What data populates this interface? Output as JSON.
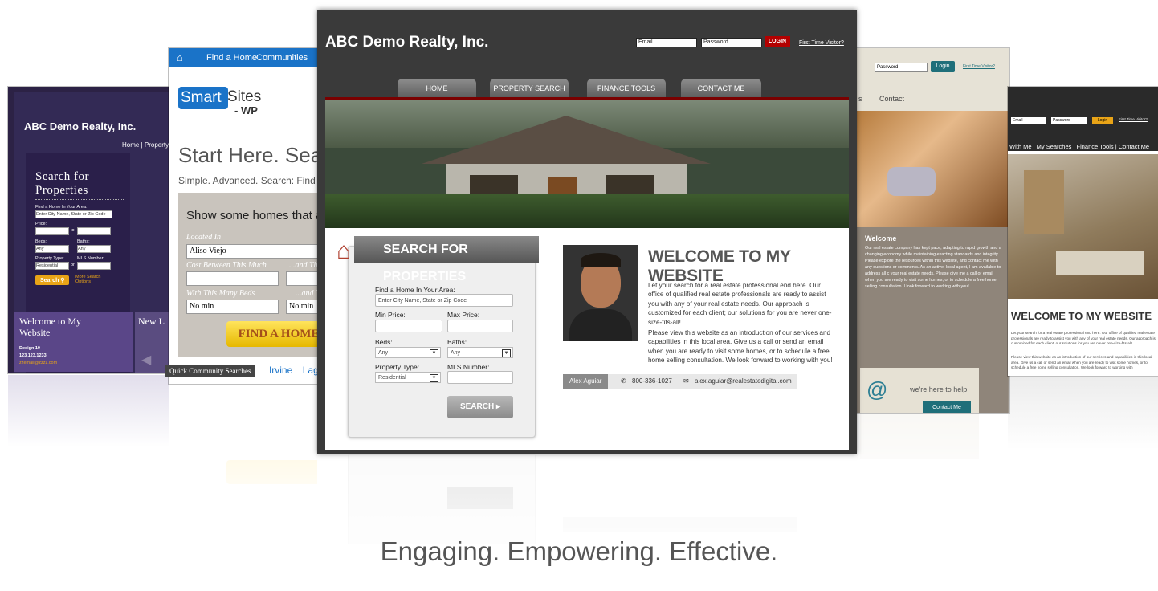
{
  "colors": {
    "main_frame": "#3a3a3a",
    "login_red": "#b30000",
    "smart_blue": "#1a73c8",
    "find_gold": "#ffd21f"
  },
  "left_site": {
    "brand": "ABC Demo Realty, Inc.",
    "nav": "Home | Property",
    "search_heading_1": "Search for",
    "search_heading_2": "Properties",
    "find_label": "Find a Home In Your Area:",
    "find_placeholder": "Enter City Name, State or Zip Code",
    "price_label": "Price:",
    "price_to": "to",
    "beds_label": "Beds:",
    "baths_label": "Baths:",
    "beds_value": "Any",
    "baths_value": "Any",
    "prop_type_label": "Property Type:",
    "mls_label": "MLS Number:",
    "prop_type_value": "Residential",
    "or": "or",
    "search_btn": "Search",
    "more_options": "More Search Options",
    "welcome_1": "Welcome to My",
    "welcome_2": "Website",
    "design": "Design 10",
    "phone": "123.123.1233",
    "email": "zzemail@zzzz.com",
    "new_label": "New L"
  },
  "smart_site": {
    "home_icon": "home-icon",
    "nav_find": "Find a Home",
    "nav_communities": "Communities",
    "logo_a": "Smart",
    "logo_b": "Sites",
    "logo_c": "- WP",
    "headline": "Start Here. Sea",
    "subheadline": "Simple. Advanced. Search: Find th",
    "panel_title": "Show some homes that are...",
    "located_label": "Located In",
    "located_value": "Aliso Viejo",
    "cost_label": "Cost Between This Much",
    "and_this": "...and Th",
    "beds_label": "With This Many Beds",
    "and_thi": "...and Thi",
    "min_value": "No min",
    "find_btn": "FIND A HOME"
  },
  "quick_search": {
    "tag": "Quick Community Searches",
    "links": [
      "Irvine",
      "Lagun"
    ]
  },
  "right_site_1": {
    "password_placeholder": "Password",
    "login_btn": "Login",
    "first_time": "First Time Visitor?",
    "nav_s": "s",
    "nav_contact": "Contact",
    "welcome_title": "Welcome",
    "welcome_text": "Our real estate company has kept pace, adapting to rapid growth and a changing economy while maintaining exacting standards and integrity. Please explore the resources within this website, and contact me with any questions or comments. As an active, local agent, I am available to address all c your real estate needs. Please give me a call or email when you are ready to visit some homes, or to schedule a free home selling consultation. I look forward to working with you!",
    "help_text": "we're here to help",
    "contact_btn": "Contact Me"
  },
  "right_site_2": {
    "email_placeholder": "Email",
    "password_placeholder": "Password",
    "login_btn": "Login",
    "first_time": "First Time Visitor?",
    "nav": "With Me | My Searches | Finance Tools | Contact Me",
    "welcome_title": "WELCOME TO MY WEBSITE",
    "welcome_text": "Let your search for a real estate professional end here. Our office of qualified real estate professionals are ready to assist you with any of your real estate needs. Our approach is customized for each client; our solutions for you are never one-size-fits-all!",
    "welcome_text_2": "Please view this website as an introduction of our services and capabilities in this local area. Give us a call or send an email when you are ready to visit some homes, or to schedule a free home selling consultation. We look forward to working with"
  },
  "main_site": {
    "brand": "ABC Demo Realty, Inc.",
    "email_placeholder": "Email",
    "password_placeholder": "Password",
    "login_btn": "LOGIN",
    "first_time": "First Time Visitor?",
    "tabs": [
      "HOME",
      "PROPERTY SEARCH",
      "FINANCE TOOLS",
      "CONTACT ME"
    ],
    "search_title": "SEARCH FOR PROPERTIES",
    "find_label": "Find a Home In Your Area:",
    "find_placeholder": "Enter City Name, State or Zip Code",
    "min_price": "Min Price:",
    "max_price": "Max Price:",
    "beds": "Beds:",
    "baths": "Baths:",
    "beds_value": "Any",
    "baths_value": "Any",
    "property_type": "Property Type:",
    "mls_number": "MLS Number:",
    "property_type_value": "Residential",
    "search_btn": "SEARCH",
    "welcome_title": "WELCOME TO MY WEBSITE",
    "para1": "Let your search for a real estate professional end here. Our office of qualified real estate professionals are ready to assist you with any of your real estate needs. Our approach is customized for each client; our solutions for you are never one-size-fits-all!",
    "para2": "Please view this website as an introduction of our services and capabilities in this local area. Give us a call or send an email when you are ready to visit some homes, or to schedule a free home selling consultation. We look forward to working with you!",
    "agent_name": "Alex Aguiar",
    "agent_phone": "800-336-1027",
    "agent_email": "alex.aguiar@realestatedigital.com"
  },
  "tagline": "Engaging.  Empowering.  Effective."
}
